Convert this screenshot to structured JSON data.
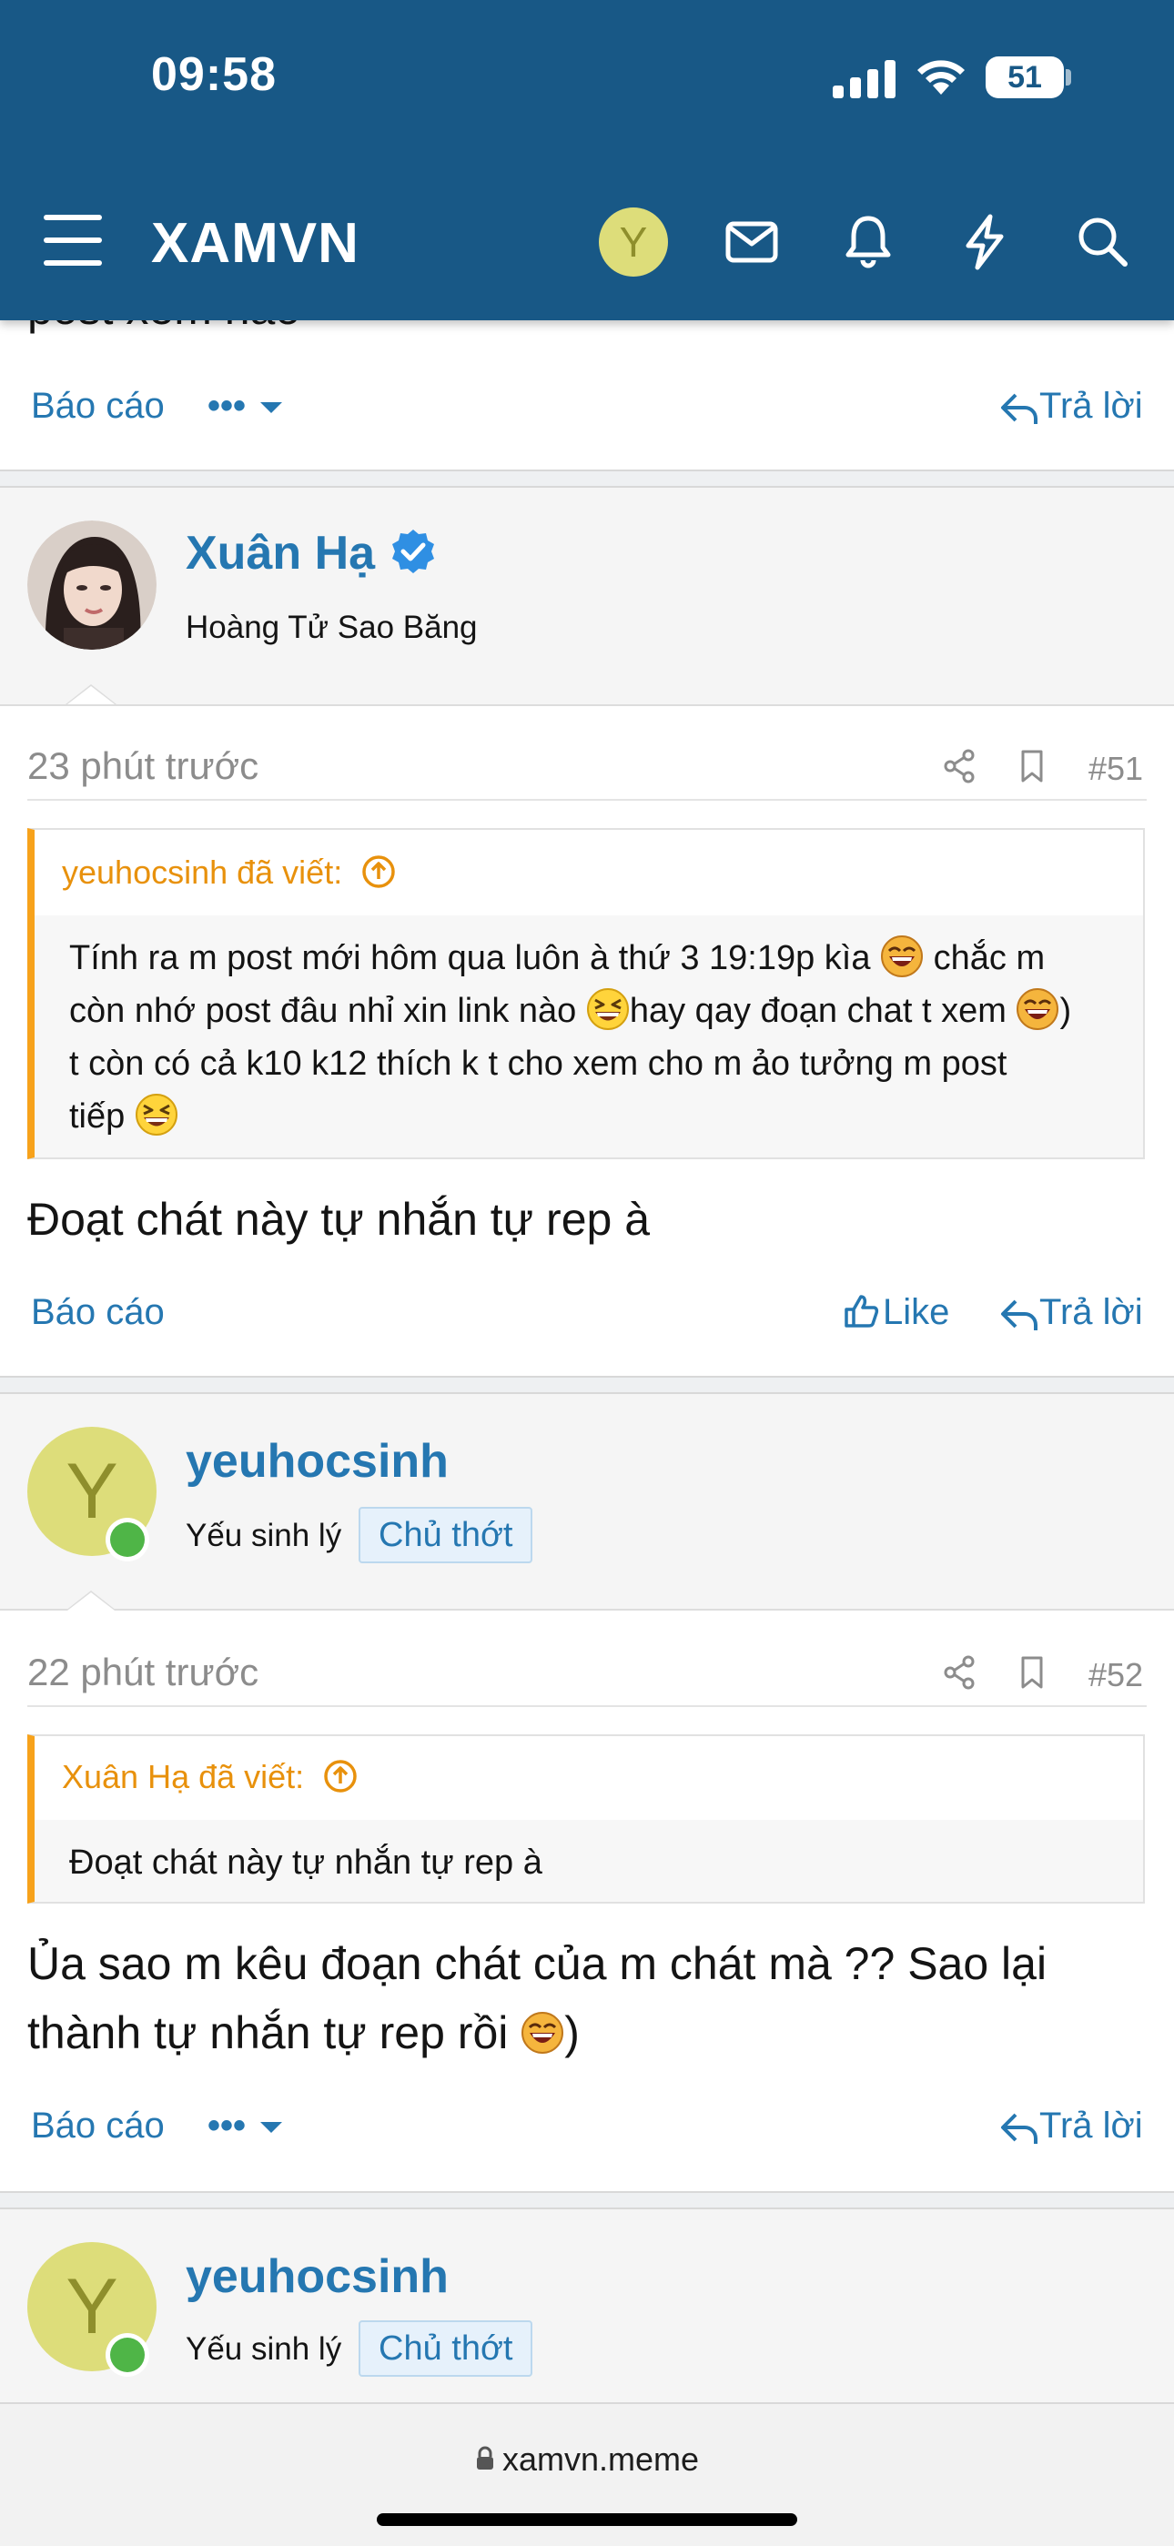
{
  "status_bar": {
    "time": "09:58",
    "battery": "51"
  },
  "header": {
    "logo": "XAMVN",
    "user_initial": "Y"
  },
  "prev_post": {
    "partial_text": "post xem nào",
    "report_label": "Báo cáo",
    "more_label": "•••",
    "reply_label": "Trả lời"
  },
  "posts": [
    {
      "username": "Xuân Hạ",
      "user_title": "Hoàng Tử Sao Băng",
      "time": "23 phút trước",
      "number": "#51",
      "quote_author": "yeuhocsinh đã viết:",
      "quote_lines": [
        "Tính ra m post mới hôm qua luôn à thứ 3 19:19p kìa",
        "chắc m",
        "còn nhớ post đâu nhỉ xin link nào",
        "hay qay đoạn chat t xem",
        ")",
        "t còn có cả k10 k12 thích k t cho xem cho m ảo tưởng m post",
        "tiếp"
      ],
      "message": "Đoạt chát này tự nhắn tự rep à",
      "report_label": "Báo cáo",
      "like_label": "Like",
      "reply_label": "Trả lời"
    },
    {
      "username": "yeuhocsinh",
      "user_initial": "Y",
      "user_title": "Yếu sinh lý",
      "badge": "Chủ thớt",
      "time": "22 phút trước",
      "number": "#52",
      "quote_author": "Xuân Hạ đã viết:",
      "quote_text": "Đoạt chát này tự nhắn tự rep à",
      "message_line1": "Ủa sao m kêu đoạn chát của m chát mà ?? Sao lại",
      "message_line2": "thành tự nhắn tự rep rồi",
      "message_tail": ")",
      "report_label": "Báo cáo",
      "more_label": "•••",
      "reply_label": "Trả lời"
    },
    {
      "username": "yeuhocsinh",
      "user_initial": "Y",
      "user_title": "Yếu sinh lý",
      "badge": "Chủ thớt"
    }
  ],
  "bottom_bar": {
    "url": "xamvn.meme"
  },
  "colors": {
    "header_bg": "#185886",
    "link": "#2577b1",
    "quote_accent": "#f7a21b",
    "online": "#4fb547"
  },
  "icons": [
    "menu-icon",
    "mail-icon",
    "bell-icon",
    "bolt-icon",
    "search-icon",
    "share-icon",
    "bookmark-icon",
    "reply-icon",
    "like-icon",
    "arrow-up-circle-icon",
    "lock-icon",
    "verified-icon",
    "laugh-emoji",
    "grin-squint-emoji"
  ]
}
